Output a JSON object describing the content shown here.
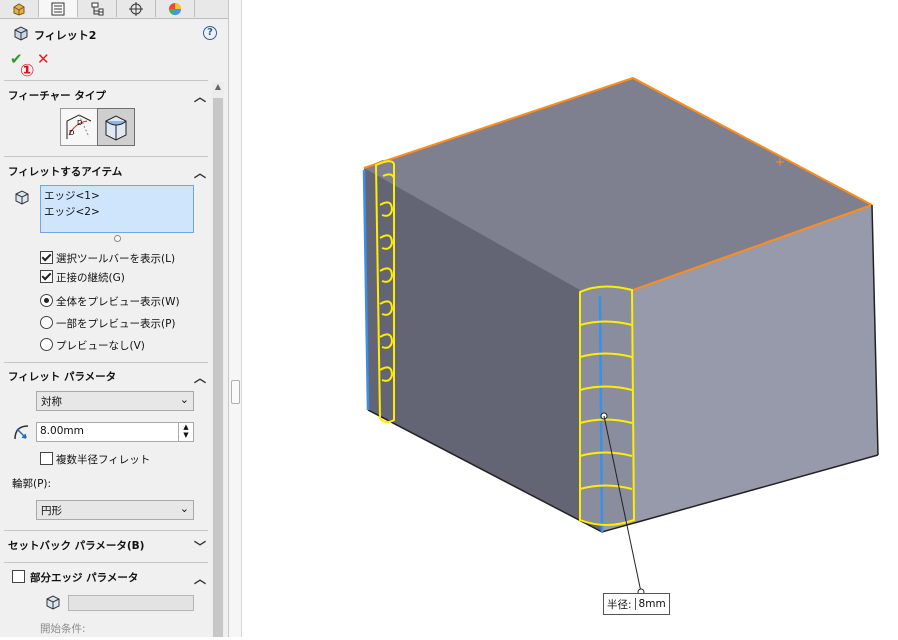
{
  "tabs": [
    {
      "icon": "feature-manager-icon"
    },
    {
      "icon": "property-manager-icon",
      "active": true
    },
    {
      "icon": "configuration-manager-icon"
    },
    {
      "icon": "dimxpert-icon"
    },
    {
      "icon": "display-manager-icon"
    }
  ],
  "pm": {
    "title": "フィレット2",
    "help": "?",
    "ok": "✔",
    "cancel": "✕",
    "callout": "①"
  },
  "feature_type": {
    "header": "フィーチャー タイプ"
  },
  "items": {
    "header": "フィレットするアイテム",
    "list": [
      "エッジ<1>",
      "エッジ<2>"
    ],
    "options": [
      {
        "label": "選択ツールバーを表示(L)",
        "checked": true
      },
      {
        "label": "正接の継続(G)",
        "checked": true
      }
    ],
    "radios": [
      {
        "label": "全体をプレビュー表示(W)",
        "selected": true
      },
      {
        "label": "一部をプレビュー表示(P)",
        "selected": false
      },
      {
        "label": "プレビューなし(V)",
        "selected": false
      }
    ]
  },
  "params": {
    "header": "フィレット パラメータ",
    "method": "対称",
    "radius": "8.00mm",
    "multi_radius": "複数半径フィレット",
    "profile_label": "輪郭(P):",
    "profile": "円形"
  },
  "setback": {
    "header": "セットバック パラメータ(B)"
  },
  "partial": {
    "header": "部分エッジ パラメータ",
    "start_label": "開始条件:"
  },
  "viewport": {
    "dim_label": "半径:",
    "dim_value": "8mm",
    "colors": {
      "top": "#7e808f",
      "left": "#646574",
      "right": "#979aab",
      "edge_highlight": "#ff8c1a",
      "fillet_preview": "#ffee00",
      "selected_edge": "#3a8fe8"
    }
  }
}
